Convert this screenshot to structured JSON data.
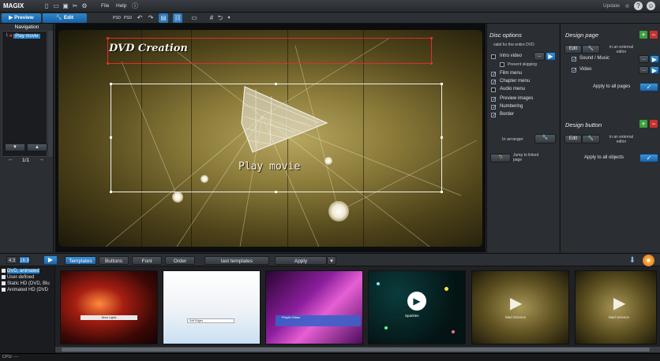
{
  "app": {
    "name": "MAGIX",
    "menu": [
      "File",
      "Help"
    ],
    "update": "Update"
  },
  "modes": {
    "preview": "Preview",
    "edit": "Edit"
  },
  "navigation": {
    "title": "Navigation",
    "item": "Play movie",
    "page": "1/1"
  },
  "menu_preview": {
    "title": "DVD Creation",
    "button": "Play movie"
  },
  "disc_options": {
    "title": "Disc options",
    "scope": "valid for the entire DVD",
    "intro_video": "Intro video",
    "prevent_skipping": "Prevent skipping",
    "film_menu": "Film menu",
    "chapter_menu": "Chapter menu",
    "audio_menu": "Audio menu",
    "preview_images": "Preview images",
    "numbering": "Numbering",
    "border": "Border",
    "in_arranger": "In arranger",
    "jump": "Jump to linked page",
    "ellipsis": "..."
  },
  "design_page": {
    "title": "Design page",
    "edit": "Edit",
    "external": "in an external editor",
    "sound": "Sound / Music",
    "video": "Video",
    "apply_all": "Apply to all pages",
    "ellipsis": "..."
  },
  "design_button": {
    "title": "Design button",
    "edit": "Edit",
    "external": "in an external editor",
    "apply_all": "Apply to all objects"
  },
  "bottom": {
    "ratio_43": "4:3",
    "ratio_169": "16:9",
    "tabs": [
      "Templates",
      "Buttons",
      "Font",
      "Order"
    ],
    "last_templates": "last templates",
    "apply": "Apply"
  },
  "template_tree": [
    "DVD, animated",
    "User-defined",
    "Static HD (DVD, Blu",
    "Animated HD (DVD"
  ],
  "thumbnails": [
    "Neon Lights",
    "Soft Edges",
    "Purple Glass",
    "Sparkles",
    "Mad Science",
    "Mad Science"
  ],
  "status": "CPU: ---",
  "colors": {
    "accent": "#2b79c0",
    "selection_red": "#d8312a",
    "add": "#3da03a",
    "remove": "#c5322d"
  }
}
